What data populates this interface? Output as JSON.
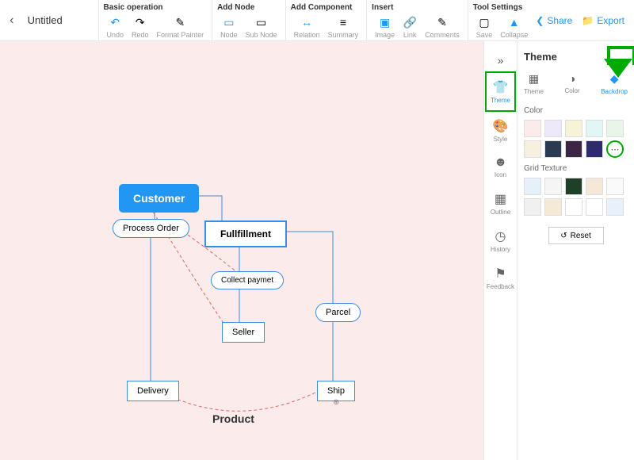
{
  "title": "Untitled",
  "toolbar": {
    "groups": [
      {
        "title": "Basic operation",
        "items": [
          {
            "label": "Undo",
            "icon": "↶",
            "blue": true
          },
          {
            "label": "Redo",
            "icon": "↷"
          },
          {
            "label": "Format Painter",
            "icon": "✎"
          }
        ]
      },
      {
        "title": "Add Node",
        "items": [
          {
            "label": "Node",
            "icon": "▭",
            "blue": true
          },
          {
            "label": "Sub Node",
            "icon": "▭"
          }
        ]
      },
      {
        "title": "Add Component",
        "items": [
          {
            "label": "Relation",
            "icon": "↔",
            "blue": true
          },
          {
            "label": "Summary",
            "icon": "≡"
          }
        ]
      },
      {
        "title": "Insert",
        "items": [
          {
            "label": "Image",
            "icon": "▣",
            "blue": true
          },
          {
            "label": "Link",
            "icon": "🔗"
          },
          {
            "label": "Comments",
            "icon": "✎"
          }
        ]
      },
      {
        "title": "Tool Settings",
        "items": [
          {
            "label": "Save",
            "icon": "▢"
          },
          {
            "label": "Collapse",
            "icon": "▲",
            "blue": true
          }
        ]
      }
    ],
    "share": "Share",
    "export": "Export"
  },
  "canvas": {
    "nodes": {
      "customer": "Customer",
      "process_order": "Process Order",
      "fullfillment": "Fullfillment",
      "collect_payment": "Collect paymet",
      "seller": "Seller",
      "parcel": "Parcel",
      "delivery": "Delivery",
      "ship": "Ship",
      "product": "Product"
    }
  },
  "sidebar": {
    "tabs": [
      {
        "label": "Theme",
        "icon": "👕",
        "active": true
      },
      {
        "label": "Style",
        "icon": "🎨"
      },
      {
        "label": "Icon",
        "icon": "☻"
      },
      {
        "label": "Outline",
        "icon": "▦"
      },
      {
        "label": "History",
        "icon": "◷"
      },
      {
        "label": "Feedback",
        "icon": "⚑"
      }
    ]
  },
  "panel": {
    "title": "Theme",
    "tabs": [
      {
        "label": "Theme",
        "icon": "▦"
      },
      {
        "label": "Color",
        "icon": "◑"
      },
      {
        "label": "Backdrop",
        "icon": "◆",
        "active": true
      }
    ],
    "color_label": "Color",
    "colors_row1": [
      "#fbeceb",
      "#eee8fb",
      "#f7f3d9",
      "#e0f7f5",
      "#e8f5e8"
    ],
    "colors_row2": [
      "#f7f0e0",
      "#2b3a50",
      "#3d2645",
      "#2e2a6e",
      "more"
    ],
    "texture_label": "Grid Texture",
    "textures_row1": [
      "#e6f0fb",
      "#f5f5f5",
      "#1e4028",
      "#f5e8d8",
      "#fafafa"
    ],
    "textures_row2": [
      "#f0f0f0",
      "#f5ead8",
      "#fff",
      "#fff",
      "#e8f0fb"
    ],
    "reset": "Reset"
  }
}
